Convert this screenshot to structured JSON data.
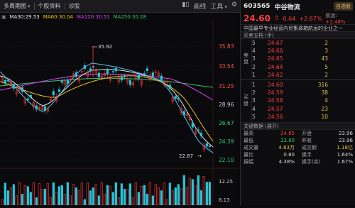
{
  "toolbar": {
    "period": "多周期图",
    "f10": "个股资料",
    "diagnose": "诊股",
    "draw": "画线",
    "tools": "工具"
  },
  "ma_legend": [
    {
      "label": "MA30:29.53",
      "color": "#e8e8e8"
    },
    {
      "label": "MA60:30.04",
      "color": "#f0c419"
    },
    {
      "label": "MA120:30.51",
      "color": "#e040fb"
    },
    {
      "label": "MA250:30.28",
      "color": "#33c46d"
    }
  ],
  "price_axis": [
    "35.83",
    "33.54",
    "31.25",
    "28.96",
    "26.67",
    "24.39",
    "22.10"
  ],
  "lower_axis": [
    "12.25",
    "6.13"
  ],
  "chart_annotations": {
    "high": "35.92",
    "low": "22.67"
  },
  "colors": {
    "up": "#ff3b3b",
    "down": "#26c6da",
    "bg": "#0a0a0c"
  },
  "stock": {
    "code": "603565",
    "name": "中谷物流",
    "badge": "自选股",
    "price": "24.60",
    "change": "0.64",
    "pct": "+2.67%",
    "sector_label": "航运:",
    "sector_pct": "+1.48%",
    "note": "中国最早专业经营内贸集装箱航运的企业之一"
  },
  "orderbook": {
    "ask_title": "买卖五档  (手)",
    "sell_label": [
      "卖",
      "盘"
    ],
    "buy_label": [
      "买",
      "盘"
    ],
    "asks": [
      {
        "lv": "5",
        "px": "24.67",
        "vol": "2"
      },
      {
        "lv": "4",
        "px": "24.66",
        "vol": "3"
      },
      {
        "lv": "3",
        "px": "24.65",
        "vol": "43"
      },
      {
        "lv": "2",
        "px": "24.64",
        "vol": "5"
      },
      {
        "lv": "1",
        "px": "24.62",
        "vol": "2"
      }
    ],
    "bids": [
      {
        "lv": "1",
        "px": "24.60",
        "vol": "316"
      },
      {
        "lv": "2",
        "px": "24.59",
        "vol": "38"
      },
      {
        "lv": "3",
        "px": "24.58",
        "vol": "4"
      },
      {
        "lv": "4",
        "px": "24.57",
        "vol": "23"
      },
      {
        "lv": "5",
        "px": "24.56",
        "vol": "10"
      }
    ]
  },
  "stats_title": "关键数据  (展开)",
  "stats": [
    {
      "k": "最高",
      "v": "24.85",
      "vc": "red",
      "k2": "开盘",
      "v2": "23.96",
      "v2c": "white"
    },
    {
      "k": "最低",
      "v": "23.80",
      "vc": "green",
      "k2": "昨收",
      "v2": "23.96",
      "v2c": "white"
    },
    {
      "k": "成交量",
      "v": "4.83万",
      "vc": "yellow",
      "k2": "成交额",
      "v2": "1.18亿",
      "v2c": "yellow"
    },
    {
      "k": "量比",
      "v": "0.80",
      "vc": "white",
      "k2": "换手",
      "v2": "1.64%",
      "v2c": "white"
    },
    {
      "k": "振幅",
      "v": "4.38%",
      "vc": "white",
      "k2": "换手(实)",
      "v2": "1.67%",
      "v2c": "white"
    }
  ]
}
